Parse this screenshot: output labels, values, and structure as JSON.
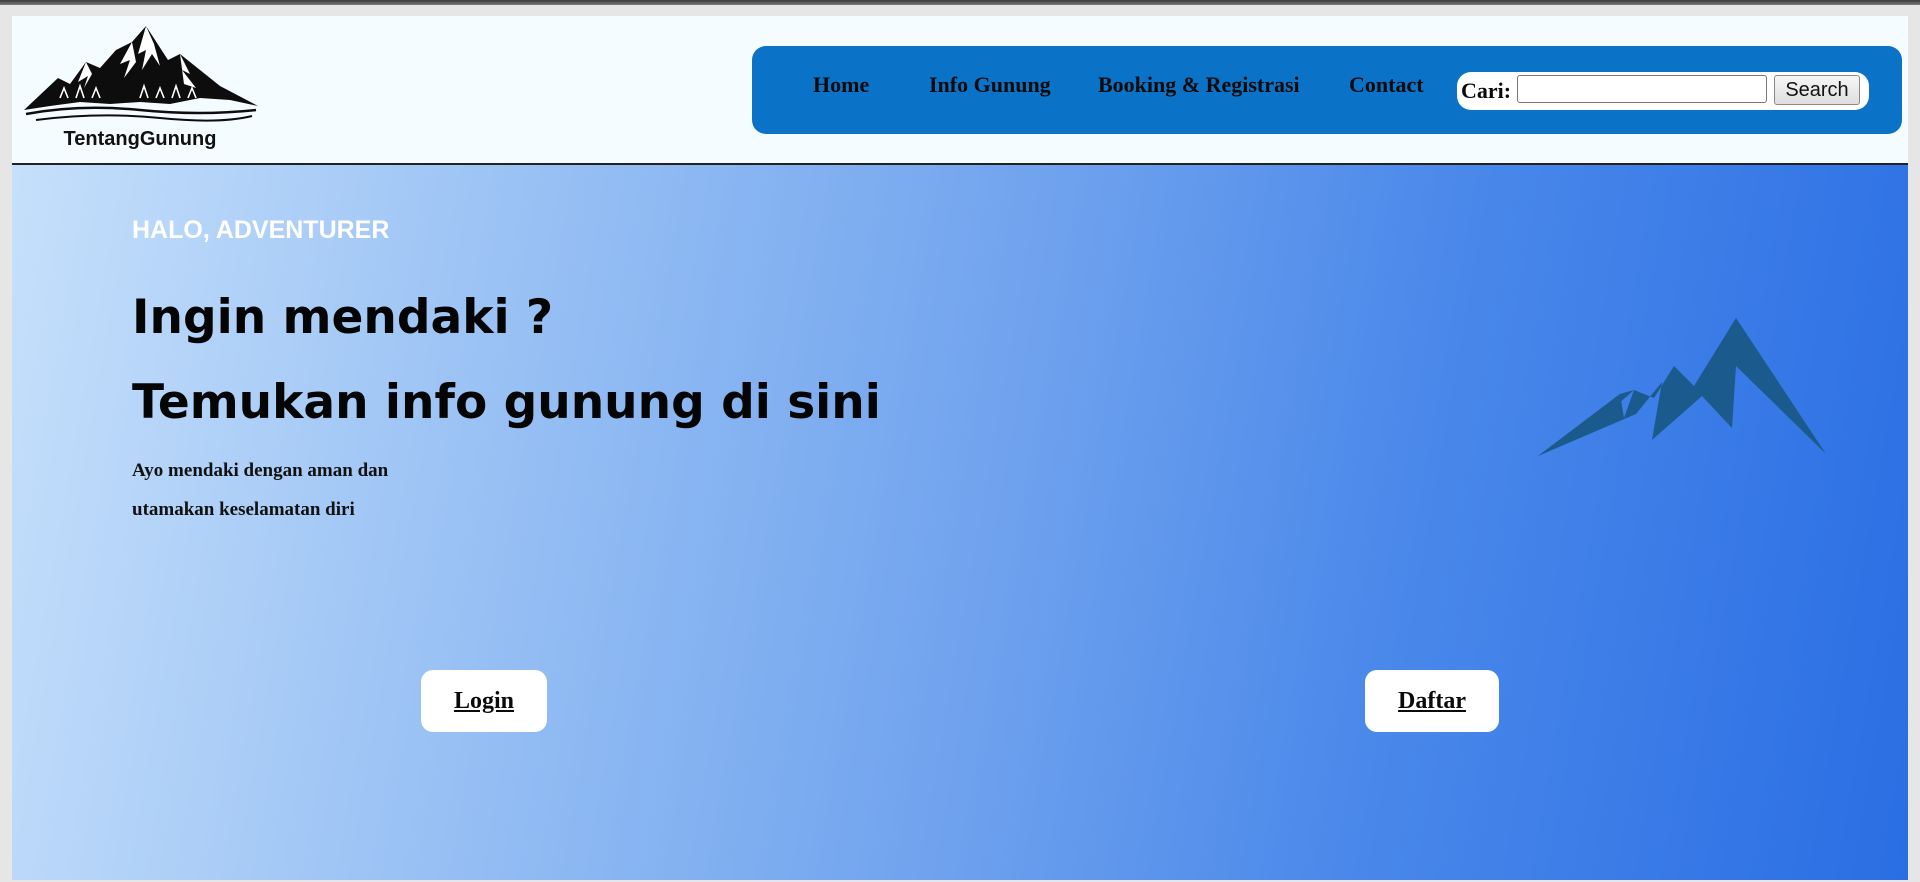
{
  "header": {
    "logo_text": "TentangGunung",
    "nav_items": [
      "Home",
      "Info Gunung",
      "Booking & Registrasi",
      "Contact"
    ],
    "search": {
      "label": "Cari:",
      "value": "",
      "placeholder": "",
      "button_label": "Search"
    }
  },
  "hero": {
    "greeting": "HALO, ADVENTURER",
    "headline_1": "Ingin mendaki ?",
    "headline_2": "Temukan info gunung di sini",
    "subtext_1": "Ayo mendaki dengan aman dan",
    "subtext_2": "utamakan keselamatan diri",
    "login_label": "Login",
    "register_label": "Daftar"
  },
  "colors": {
    "nav_background": "#0a73c8",
    "header_background": "#f5fcff",
    "mountain_graphic": "#1a5a8c",
    "hero_gradient_start": "#c6e0fb",
    "hero_gradient_end": "#2a6ee4"
  },
  "icons": {
    "logo": "mountain-logo-icon",
    "hero_graphic": "mountain-icon"
  }
}
